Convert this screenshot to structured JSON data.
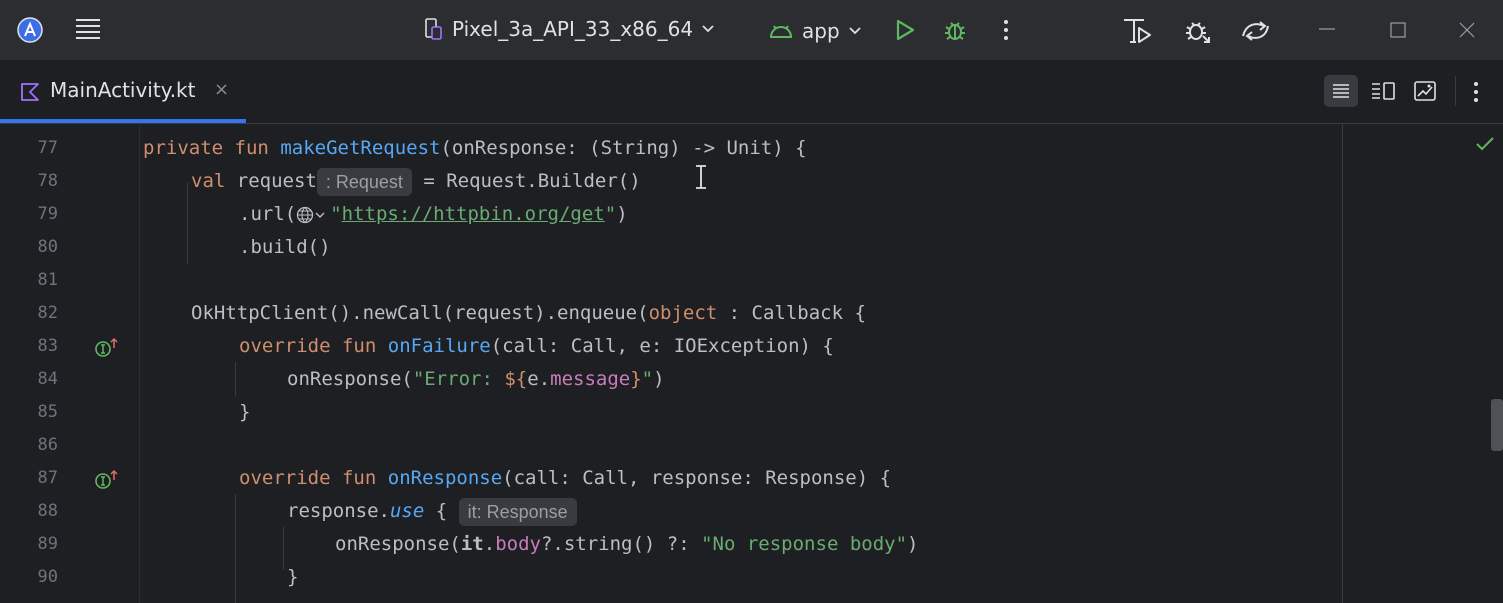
{
  "titlebar": {
    "device": "Pixel_3a_API_33_x86_64",
    "run_config": "app"
  },
  "tab": {
    "label": "MainActivity.kt",
    "close": "×"
  },
  "hints": {
    "request_type": ": Request",
    "it_type": "it: Response"
  },
  "lines": [
    {
      "n": "77"
    },
    {
      "n": "78"
    },
    {
      "n": "79"
    },
    {
      "n": "80"
    },
    {
      "n": "81"
    },
    {
      "n": "82"
    },
    {
      "n": "83"
    },
    {
      "n": "84"
    },
    {
      "n": "85"
    },
    {
      "n": "86"
    },
    {
      "n": "87"
    },
    {
      "n": "88"
    },
    {
      "n": "89"
    },
    {
      "n": "90"
    }
  ],
  "code": {
    "l77": {
      "kw1": "private",
      "kw2": "fun",
      "fn": "makeGetRequest",
      "rest": "(onResponse: (String) -> Unit) {"
    },
    "l78": {
      "kw": "val",
      "name": "request",
      "rest": " = Request.Builder()"
    },
    "l79": {
      "pre": ".url(",
      "q1": "\"",
      "url": "https://httpbin.org/get",
      "q2": "\"",
      "post": ")"
    },
    "l80": {
      "text": ".build()"
    },
    "l82": {
      "pre": "OkHttpClient().newCall(request).enqueue(",
      "kw": "object",
      "post": " : Callback {"
    },
    "l83": {
      "kw1": "override",
      "kw2": "fun",
      "fn": "onFailure",
      "rest": "(call: Call, e: IOException) {"
    },
    "l84": {
      "pre": "onResponse(",
      "s1": "\"Error: ",
      "tmpl": "${",
      "obj": "e.",
      "prop": "message",
      "tmpl2": "}",
      "s2": "\"",
      "post": ")"
    },
    "l85": {
      "text": "}"
    },
    "l87": {
      "kw1": "override",
      "kw2": "fun",
      "fn": "onResponse",
      "rest": "(call: Call, response: Response) {"
    },
    "l88": {
      "pre": "response.",
      "it": "use",
      "post": " {"
    },
    "l89": {
      "pre": "onResponse(",
      "bold": "it",
      "dot": ".",
      "prop": "body",
      "mid": "?.string() ?: ",
      "str": "\"No response body\"",
      "post": ")"
    },
    "l90": {
      "text": "}"
    }
  },
  "colors": {
    "accent": "#3574f0",
    "keyword": "#cf8e6d",
    "function": "#56a8f5",
    "string": "#6aab73",
    "property": "#c77dbb",
    "run_green": "#5fb85f"
  }
}
